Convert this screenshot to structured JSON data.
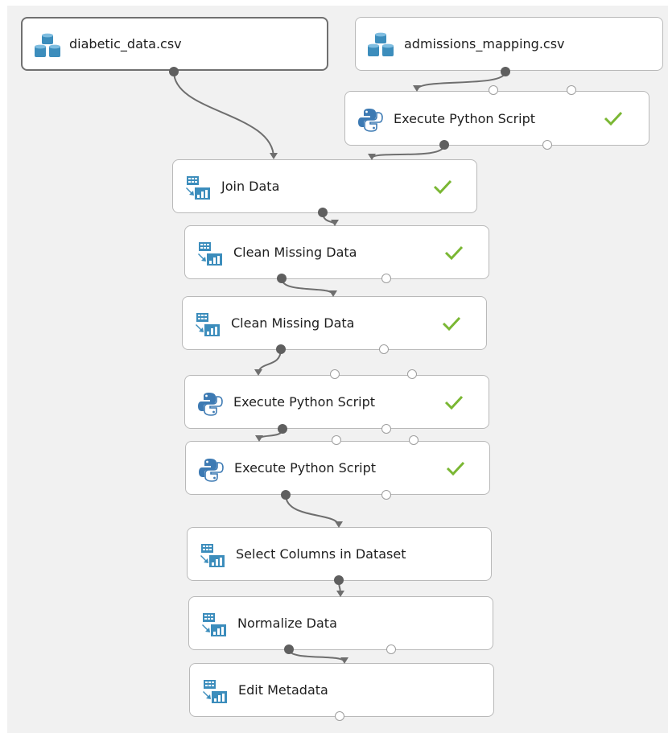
{
  "modules": [
    {
      "label": "diabetic_data.csv",
      "icon": "dataset-icon",
      "status": ""
    },
    {
      "label": "admissions_mapping.csv",
      "icon": "dataset-icon",
      "status": ""
    },
    {
      "label": "Execute Python Script",
      "icon": "python-icon",
      "status": "finished"
    },
    {
      "label": "Join Data",
      "icon": "data-transform-icon",
      "status": "finished"
    },
    {
      "label": "Clean Missing Data",
      "icon": "data-transform-icon",
      "status": "finished"
    },
    {
      "label": "Clean Missing Data",
      "icon": "data-transform-icon",
      "status": "finished"
    },
    {
      "label": "Execute Python Script",
      "icon": "python-icon",
      "status": "finished"
    },
    {
      "label": "Execute Python Script",
      "icon": "python-icon",
      "status": "finished"
    },
    {
      "label": "Select Columns in Dataset",
      "icon": "data-transform-icon",
      "status": ""
    },
    {
      "label": "Normalize Data",
      "icon": "data-transform-icon",
      "status": ""
    },
    {
      "label": "Edit Metadata",
      "icon": "data-transform-icon",
      "status": ""
    }
  ],
  "colors": {
    "canvas_background": "#f1f1f1",
    "icon_blue": "#3c8dbc",
    "check_green": "#7ab733",
    "wire": "#6e6e6e"
  }
}
